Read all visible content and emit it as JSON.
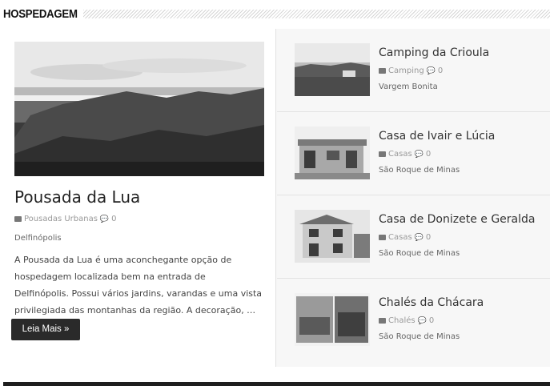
{
  "section": {
    "title": "HOSPEDAGEM"
  },
  "featured": {
    "title": "Pousada da Lua",
    "category": "Pousadas Urbanas",
    "comments": "0",
    "location": "Delfinópolis",
    "excerpt": "A Pousada da Lua é uma aconchegante opção de hospedagem localizada bem na entrada de Delfinópolis. Possui vários jardins, varandas e uma vista privilegiada das montanhas da região. A decoração, …",
    "button": "Leia Mais »"
  },
  "items": [
    {
      "title": "Camping da Crioula",
      "category": "Camping",
      "comments": "0",
      "location": "Vargem Bonita"
    },
    {
      "title": "Casa de Ivair e Lúcia",
      "category": "Casas",
      "comments": "0",
      "location": "São Roque de Minas"
    },
    {
      "title": "Casa de Donizete e Geralda",
      "category": "Casas",
      "comments": "0",
      "location": "São Roque de Minas"
    },
    {
      "title": "Chalés da Chácara",
      "category": "Chalés",
      "comments": "0",
      "location": "São Roque de Minas"
    }
  ]
}
